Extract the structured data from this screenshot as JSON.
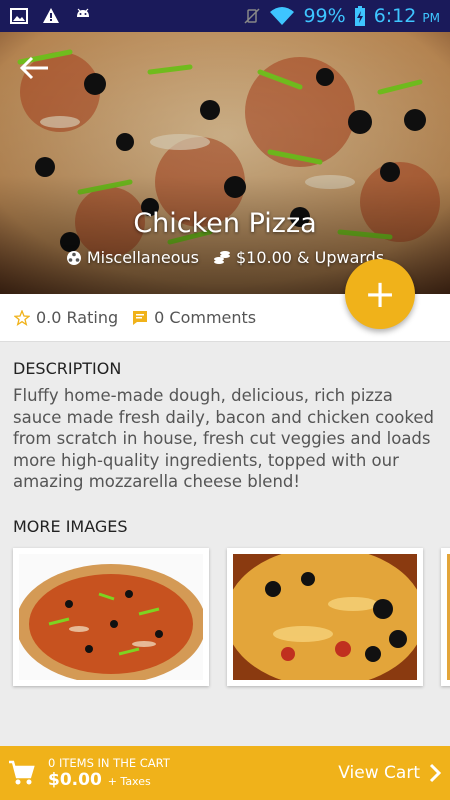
{
  "status": {
    "battery": "99%",
    "time": "6:12",
    "ampm": "PM"
  },
  "product": {
    "title": "Chicken Pizza",
    "category": "Miscellaneous",
    "price": "$10.00 & Upwards",
    "rating": "0.0 Rating",
    "comments": "0 Comments"
  },
  "fab_label": "+",
  "description": {
    "heading": "DESCRIPTION",
    "text": "Fluffy home-made dough, delicious, rich pizza sauce made fresh daily, bacon and chicken cooked from scratch in house, fresh cut veggies and loads more high-quality ingredients, topped with our amazing mozzarella cheese blend!"
  },
  "more_images": {
    "heading": "MORE IMAGES"
  },
  "cart": {
    "items_label": "0 ITEMS IN THE CART",
    "total": "$0.00",
    "taxes": "+ Taxes",
    "view_label": "View Cart"
  },
  "colors": {
    "accent": "#f0b21a",
    "statusbar": "#1a1a5a"
  }
}
